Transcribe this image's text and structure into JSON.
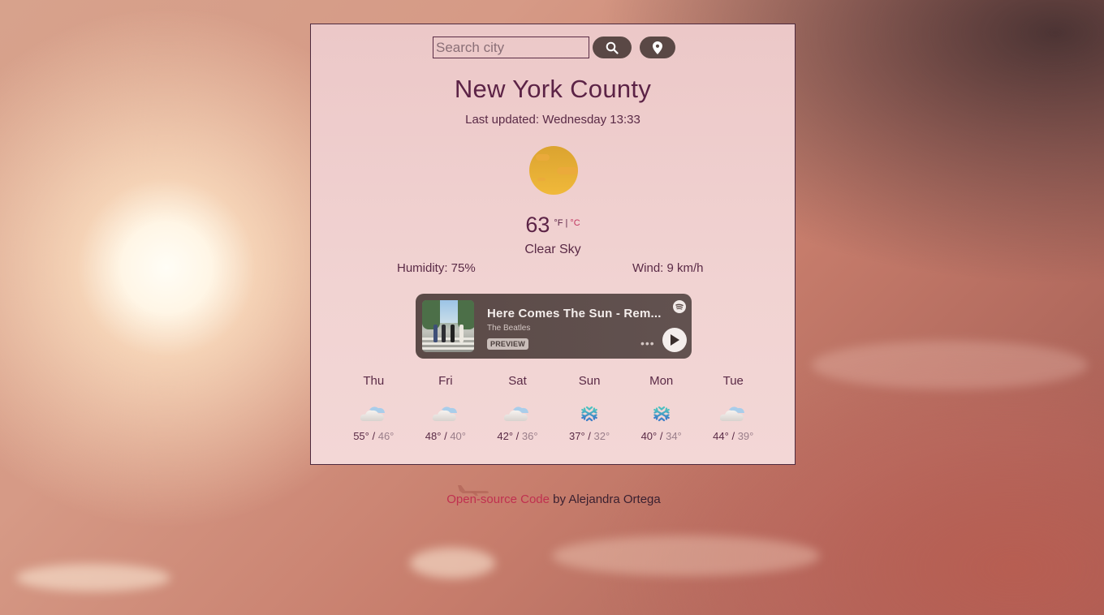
{
  "search": {
    "placeholder": "Search city",
    "value": "",
    "search_icon": "search-icon",
    "location_icon": "location-pin-icon"
  },
  "weather": {
    "city": "New York County",
    "last_updated": "Last updated: Wednesday 13:33",
    "icon": "clear-sky-sun-icon",
    "temperature": "63",
    "unit_f": "°F",
    "unit_separator": "|",
    "unit_c": "°C",
    "description": "Clear Sky",
    "humidity": "Humidity: 75%",
    "wind": "Wind: 9 km/h"
  },
  "player": {
    "song": "Here Comes The Sun - Rem...",
    "artist": "The Beatles",
    "badge": "PREVIEW",
    "service_icon": "spotify-icon",
    "more_icon": "more-dots-icon",
    "play_icon": "play-icon",
    "colors": {
      "background": "#5b4a47",
      "text": "#f4eeec"
    }
  },
  "forecast": [
    {
      "day": "Thu",
      "icon": "cloud-icon",
      "high": "55°",
      "low": "46°"
    },
    {
      "day": "Fri",
      "icon": "cloud-icon",
      "high": "48°",
      "low": "40°"
    },
    {
      "day": "Sat",
      "icon": "cloud-icon",
      "high": "42°",
      "low": "36°"
    },
    {
      "day": "Sun",
      "icon": "snowflake-icon",
      "high": "37°",
      "low": "32°"
    },
    {
      "day": "Mon",
      "icon": "snowflake-icon",
      "high": "40°",
      "low": "34°"
    },
    {
      "day": "Tue",
      "icon": "cloud-icon",
      "high": "44°",
      "low": "39°"
    }
  ],
  "temp_separator": " / ",
  "footer": {
    "link_text": "Open-source Code",
    "rest_text": " by Alejandra Ortega"
  },
  "colors": {
    "primary_text": "#5c2346",
    "link": "#c0304f",
    "button": "#5a4845",
    "card_background": "#f1d3d2"
  }
}
